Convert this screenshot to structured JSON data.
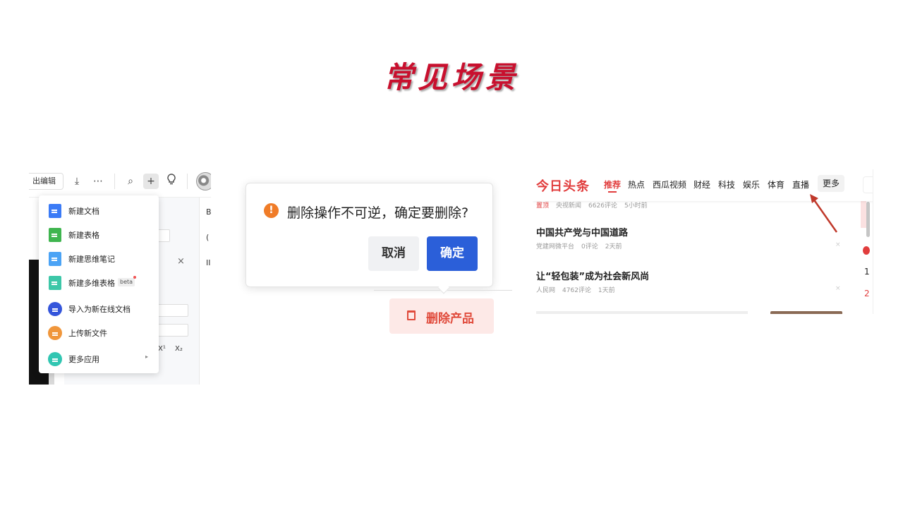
{
  "slide": {
    "title": "常见场景"
  },
  "editor": {
    "toolbar": {
      "edit_label": "出编辑",
      "download_icon": "⤓",
      "more_icon": "⋯",
      "search_icon": "⌕",
      "add_icon": "+",
      "idea_icon": "💡"
    },
    "right_col": [
      "B",
      "(",
      "II"
    ],
    "bg_superscript": "X¹",
    "bg_subscript": "X₂",
    "bg_close": "×",
    "menu": {
      "items": [
        {
          "label": "新建文档",
          "color": "#3b7bf6"
        },
        {
          "label": "新建表格",
          "color": "#3fb54f"
        },
        {
          "label": "新建思维笔记",
          "color": "#4ba3f5"
        },
        {
          "label": "新建多维表格",
          "color": "#3dc7a8",
          "badge": "beta"
        },
        {
          "label": "导入为新在线文档",
          "color": "#3455db"
        },
        {
          "label": "上传新文件",
          "color": "#f0963b"
        },
        {
          "label": "更多应用",
          "color": "#31c6b2",
          "caret": "▸"
        }
      ]
    }
  },
  "confirm": {
    "icon": "!",
    "message": "删除操作不可逆，确定要删除?",
    "cancel_label": "取消",
    "ok_label": "确定",
    "delete_product_label": "删除产品",
    "colors": {
      "primary": "#2b5fd9",
      "danger": "#e04a3b",
      "warning": "#f07c28"
    }
  },
  "news": {
    "logo": "今日头条",
    "tabs": [
      "推荐",
      "热点",
      "西瓜视频",
      "财经",
      "科技",
      "娱乐",
      "体育",
      "直播"
    ],
    "more_label": "更多",
    "pinned_meta": {
      "tag": "置顶",
      "source": "央视新闻",
      "comments": "6626评论",
      "time": "5小时前"
    },
    "articles": [
      {
        "title": "中国共产党与中国道路",
        "source": "党建网微平台",
        "comments": "0评论",
        "time": "2天前"
      },
      {
        "title": "让“轻包装”成为社会新风尚",
        "source": "人民网",
        "comments": "4762评论",
        "time": "1天前"
      }
    ],
    "close_icon": "×",
    "peek": [
      "1",
      "2"
    ],
    "accent": "#e13d3d"
  }
}
